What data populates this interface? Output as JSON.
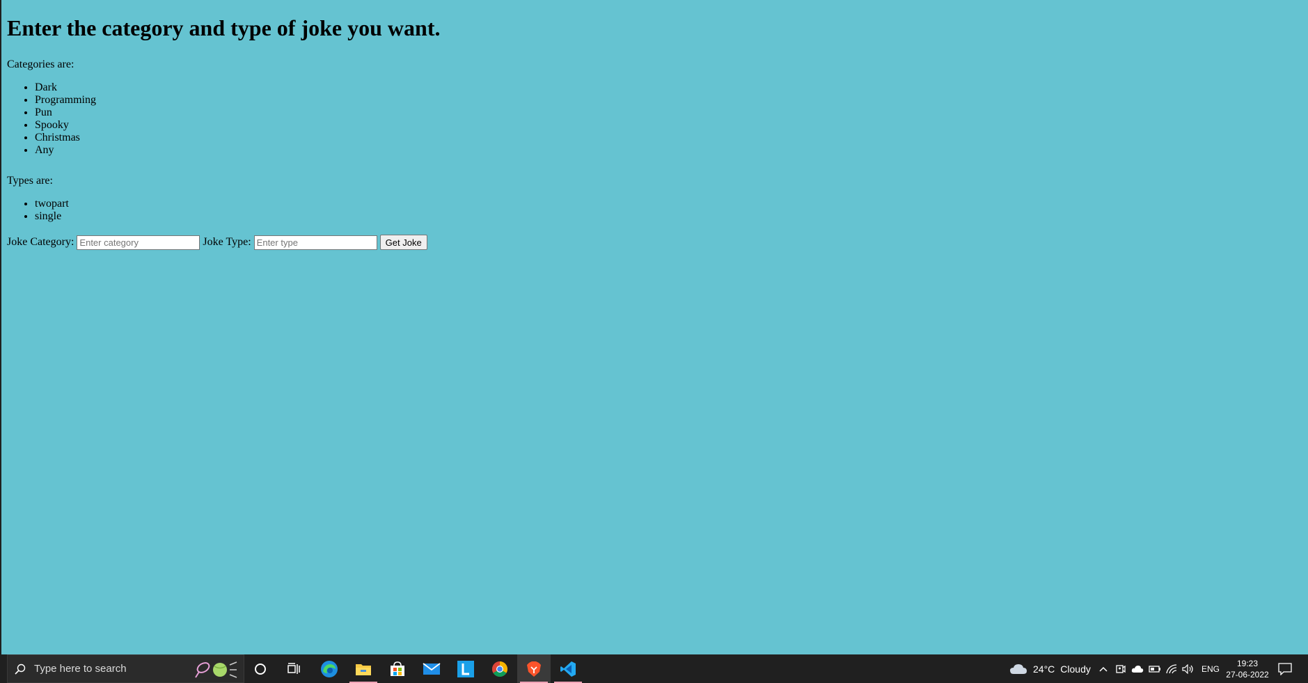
{
  "page": {
    "heading": "Enter the category and type of joke you want.",
    "categories_label": "Categories are:",
    "categories": [
      "Dark",
      "Programming",
      "Pun",
      "Spooky",
      "Christmas",
      "Any"
    ],
    "types_label": "Types are:",
    "types": [
      "twopart",
      "single"
    ],
    "form": {
      "category_label": "Joke Category:",
      "category_value": "",
      "category_placeholder": "Enter category",
      "type_label": "Joke Type:",
      "type_value": "",
      "type_placeholder": "Enter type",
      "submit_label": "Get Joke"
    },
    "background_color": "#65c3d1"
  },
  "taskbar": {
    "search_placeholder": "Type here to search",
    "apps": [
      "cortana-icon",
      "task-view-icon",
      "edge-icon",
      "file-explorer-icon",
      "store-icon",
      "mail-icon",
      "l-app-icon",
      "chrome-icon",
      "brave-icon",
      "vscode-icon"
    ],
    "weather": {
      "temperature": "24°C",
      "condition": "Cloudy"
    },
    "language": "ENG",
    "time": "19:23",
    "date": "27-06-2022"
  }
}
